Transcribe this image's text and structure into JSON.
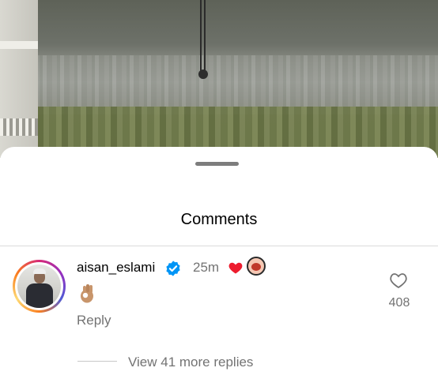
{
  "sheet": {
    "title": "Comments"
  },
  "comment": {
    "username": "aisan_eslami",
    "time": "25m",
    "body_emoji": "👌",
    "reply_label": "Reply",
    "like_count": "408",
    "view_more_label": "View 41 more replies"
  },
  "colors": {
    "verified_badge": "#0095f6",
    "heart": "#ed1c2e",
    "secondary_text": "#737373"
  },
  "icons": {
    "verified": "verified-badge-icon",
    "heart_reaction": "red-heart-icon",
    "like": "heart-outline-icon",
    "sticker": "face-sticker-icon",
    "emoji": "ok-hand-icon"
  }
}
